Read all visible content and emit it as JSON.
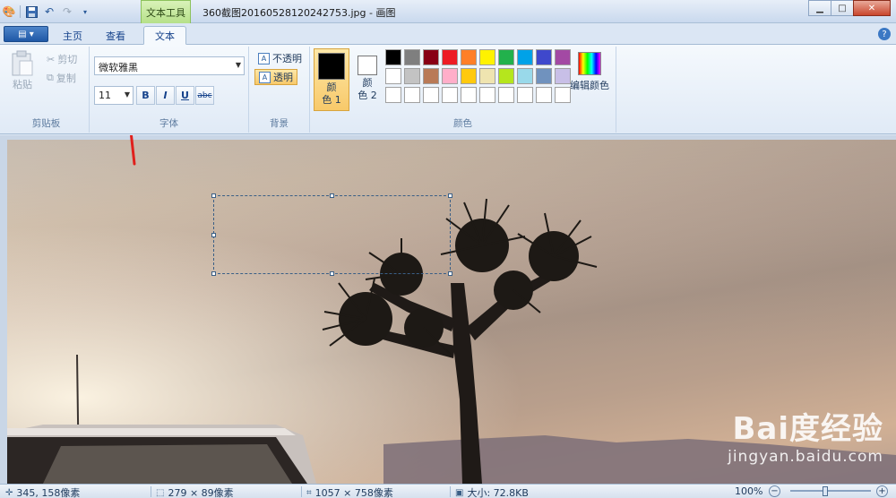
{
  "window": {
    "title": "360截图20160528120242753.jpg - 画图",
    "context_tab": "文本工具",
    "controls": {
      "minimize": "▁",
      "maximize": "□",
      "close": "✕"
    }
  },
  "quick_access": [
    "save-icon",
    "undo-icon",
    "redo-icon",
    "customize-icon"
  ],
  "tabs": [
    {
      "label": "主页",
      "active": false
    },
    {
      "label": "查看",
      "active": false
    },
    {
      "label": "文本",
      "active": true
    }
  ],
  "clipboard": {
    "paste": "粘贴",
    "cut": "剪切",
    "copy": "复制",
    "group_label": "剪贴板"
  },
  "font": {
    "family": "微软雅黑",
    "size": "11",
    "bold": "B",
    "italic": "I",
    "underline": "U",
    "strikethrough": "abc",
    "group_label": "字体"
  },
  "background": {
    "opaque": "不透明",
    "transparent": "透明",
    "group_label": "背景"
  },
  "colors": {
    "color1_line1": "颜",
    "color1_line2": "色 1",
    "color2_line1": "颜",
    "color2_line2": "色 2",
    "color1": "#000000",
    "color2": "#ffffff",
    "edit_colors": "编辑颜色",
    "group_label": "颜色",
    "palette_row1": [
      "#000000",
      "#7f7f7f",
      "#880015",
      "#ed1c24",
      "#ff7f27",
      "#fff200",
      "#22b14c",
      "#00a2e8",
      "#3f48cc",
      "#a349a4"
    ],
    "palette_row2": [
      "#ffffff",
      "#c3c3c3",
      "#b97a57",
      "#ffaec9",
      "#ffc90e",
      "#efe4b0",
      "#b5e61d",
      "#99d9ea",
      "#7092be",
      "#c8bfe7"
    ],
    "palette_row3": [
      "#ffffff",
      "#ffffff",
      "#ffffff",
      "#ffffff",
      "#ffffff",
      "#ffffff",
      "#ffffff",
      "#ffffff",
      "#ffffff",
      "#ffffff"
    ]
  },
  "watermark": {
    "brand": "Bai度经验",
    "url": "jingyan.baidu.com"
  },
  "status": {
    "cursor": "345, 158像素",
    "selection": "279 × 89像素",
    "image_size": "1057 × 758像素",
    "file_size": "大小: 72.8KB",
    "zoom": "100%",
    "zoom_out": "−",
    "zoom_in": "+"
  }
}
